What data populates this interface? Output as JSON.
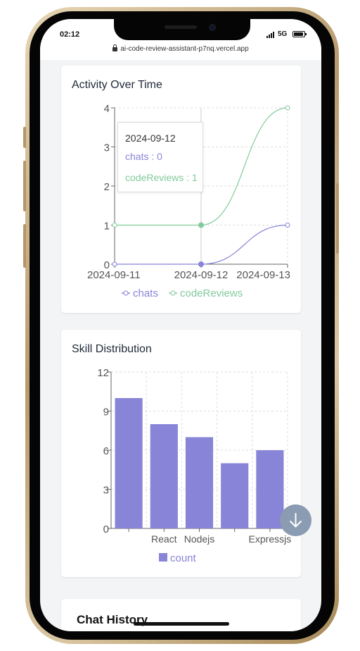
{
  "status_bar": {
    "time": "02:12",
    "network": "5G",
    "url": "ai-code-review-assistant-p7nq.vercel.app"
  },
  "activity_card": {
    "title": "Activity Over Time",
    "tooltip": {
      "date": "2024-09-12",
      "chats_line": "chats : 0",
      "code_reviews_line": "codeReviews : 1"
    }
  },
  "skill_card": {
    "title": "Skill Distribution"
  },
  "chat_history": {
    "title": "Chat History"
  },
  "colors": {
    "chats": "#8884d8",
    "code_reviews": "#82ca9d",
    "bar": "#8884d8",
    "scroll_button": "#8a9bb2"
  },
  "icons": {
    "scroll_down": "arrow-down-icon",
    "lock": "lock-icon",
    "signal": "signal-icon",
    "battery": "battery-icon"
  },
  "chart_data": [
    {
      "type": "line",
      "x": [
        "2024-09-11",
        "2024-09-12",
        "2024-09-13"
      ],
      "series": [
        {
          "name": "chats",
          "values": [
            0,
            0,
            1
          ],
          "color": "#8884d8"
        },
        {
          "name": "codeReviews",
          "values": [
            1,
            1,
            4
          ],
          "color": "#82ca9d"
        }
      ],
      "y_ticks": [
        "0",
        "1",
        "2",
        "3",
        "4"
      ],
      "ylim": [
        0,
        4
      ],
      "grid": true,
      "legend": "bottom",
      "active_index": 1
    },
    {
      "type": "bar",
      "categories": [
        "",
        "React",
        "Nodejs",
        "",
        "Expressjs"
      ],
      "series": [
        {
          "name": "count",
          "values": [
            10,
            8,
            7,
            5,
            6
          ],
          "color": "#8884d8"
        }
      ],
      "y_ticks": [
        "0",
        "3",
        "6",
        "9",
        "12"
      ],
      "ylim": [
        0,
        12
      ],
      "grid": true,
      "legend": "bottom"
    }
  ]
}
